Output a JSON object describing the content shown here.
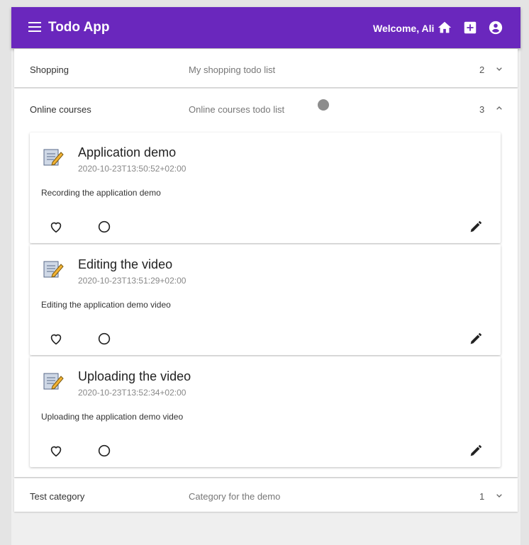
{
  "app": {
    "title": "Todo App",
    "welcome": "Welcome, Ali",
    "accent_color": "#6a27bd",
    "icons": [
      "menu-icon",
      "home-icon",
      "add-box-icon",
      "account-circle-icon"
    ]
  },
  "categories": [
    {
      "name": "Shopping",
      "description": "My shopping todo list",
      "count": "2",
      "expanded": false
    },
    {
      "name": "Online courses",
      "description": "Online courses todo list",
      "count": "3",
      "expanded": true
    },
    {
      "name": "Test category",
      "description": "Category for the demo",
      "count": "1",
      "expanded": false
    }
  ],
  "todos": [
    {
      "title": "Application demo",
      "date": "2020-10-23T13:50:52+02:00",
      "description": "Recording the application demo"
    },
    {
      "title": "Editing the video",
      "date": "2020-10-23T13:51:29+02:00",
      "description": "Editing the application demo video"
    },
    {
      "title": "Uploading the video",
      "date": "2020-10-23T13:52:34+02:00",
      "description": "Uploading the application demo video"
    }
  ]
}
